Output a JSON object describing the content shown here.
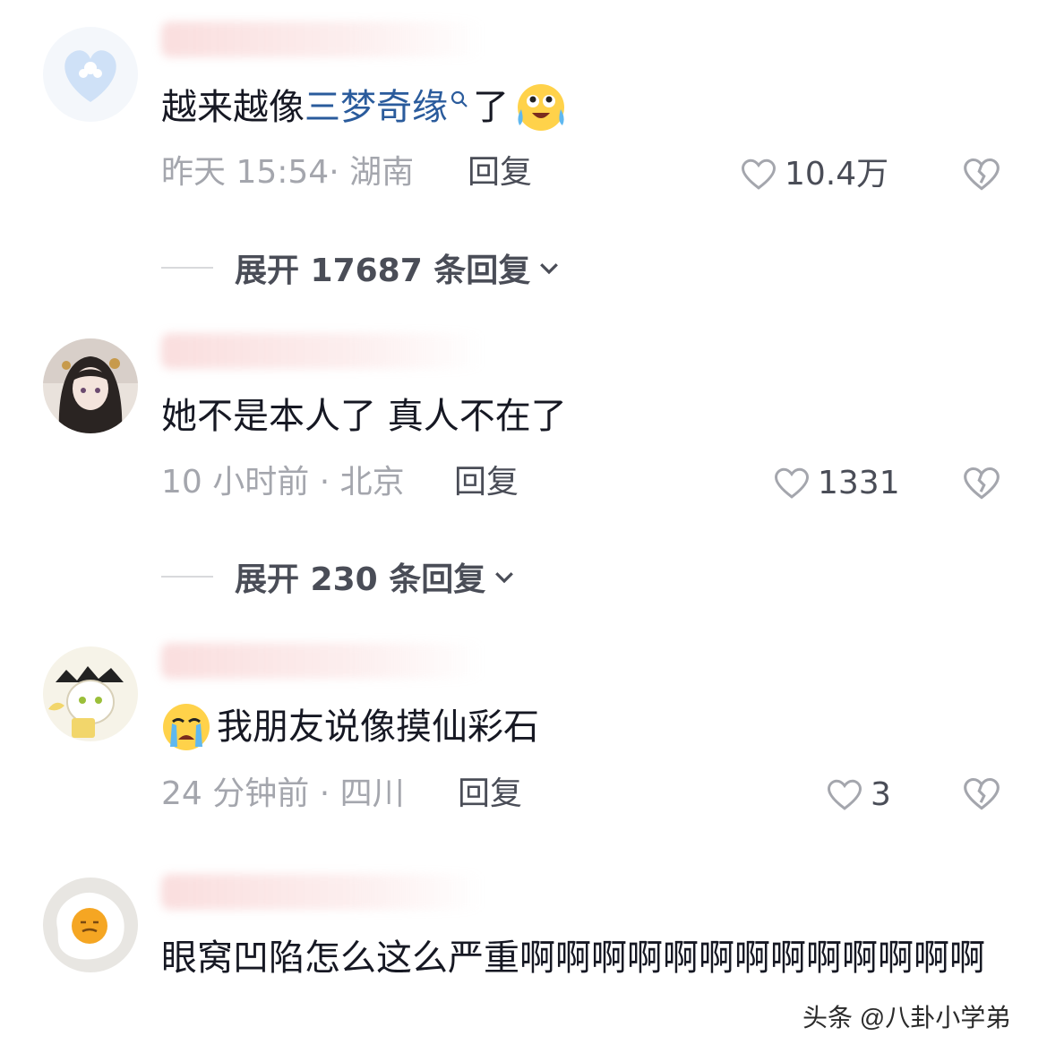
{
  "comments": [
    {
      "text_before": "越来越像",
      "link": "三梦奇缘",
      "text_after": "了",
      "emoji": "laugh-cry-emoji",
      "time_location": "昨天 15:54· 湖南",
      "reply": "回复",
      "likes": "10.4万",
      "expand": "展开 17687 条回复"
    },
    {
      "text": "她不是本人了 真人不在了",
      "time_location": "10 小时前 · 北京",
      "reply": "回复",
      "likes": "1331",
      "expand": "展开 230 条回复"
    },
    {
      "emoji": "crying-emoji",
      "text": "我朋友说像摸仙彩石",
      "time_location": "24 分钟前 · 四川",
      "reply": "回复",
      "likes": "3"
    },
    {
      "text": "眼窝凹陷怎么这么严重啊啊啊啊啊啊啊啊啊啊啊啊啊"
    }
  ],
  "watermark": "头条 @八卦小学弟",
  "colors": {
    "link": "#2a5b9c",
    "meta": "#a4a6ad",
    "action": "#4a4d57"
  }
}
